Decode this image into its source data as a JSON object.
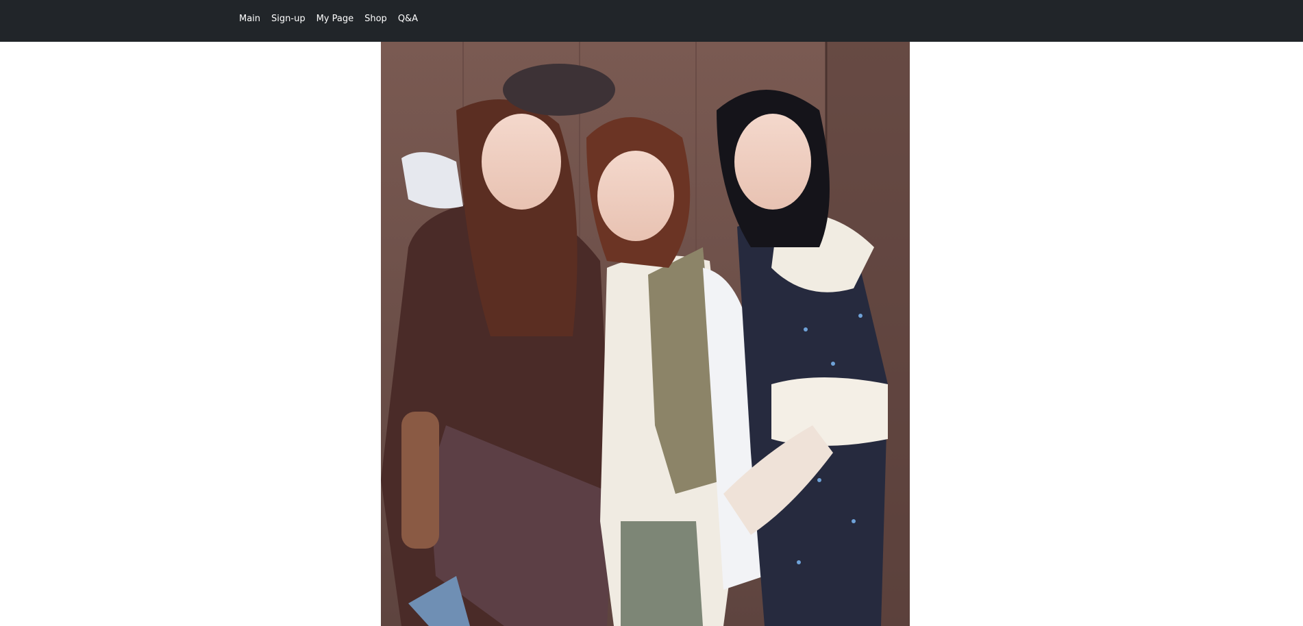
{
  "nav": {
    "items": [
      {
        "label": "Main"
      },
      {
        "label": "Sign-up"
      },
      {
        "label": "My Page"
      },
      {
        "label": "Shop"
      },
      {
        "label": "Q&A"
      }
    ]
  },
  "hero": {
    "image_subject": "three-women-photo"
  },
  "colors": {
    "navbar_background": "#212529",
    "nav_text": "#ffffff",
    "page_background": "#ffffff",
    "photo_wall": "#6e5049"
  }
}
